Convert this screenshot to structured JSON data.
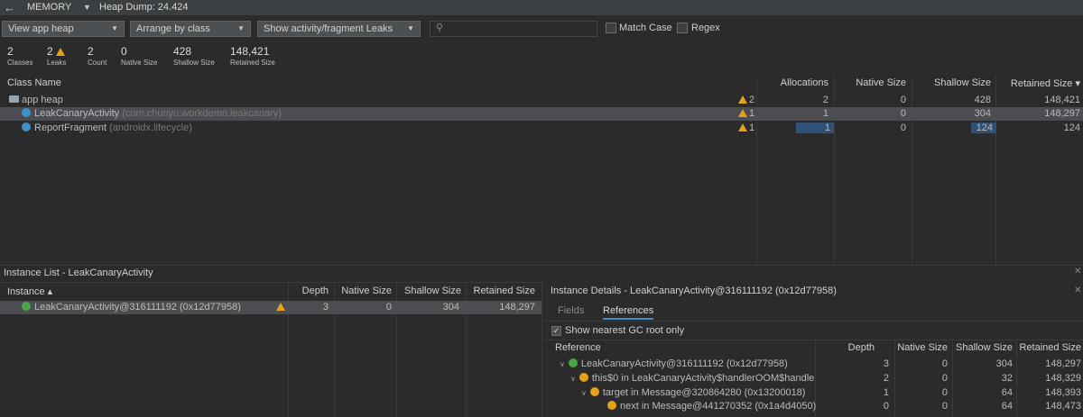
{
  "topbar": {
    "back_icon": "back-arrow-icon",
    "memory_label": "MEMORY",
    "heap_dump": "Heap Dump: 24.424"
  },
  "toolbar": {
    "heap_select": "View app heap",
    "arrange_select": "Arrange by class",
    "leak_select": "Show activity/fragment Leaks",
    "search_placeholder": "",
    "match_case": "Match Case",
    "regex": "Regex"
  },
  "stats": [
    {
      "value": "2",
      "label": "Classes"
    },
    {
      "value": "2",
      "label": "Leaks"
    },
    {
      "value": "2",
      "label": "Count"
    },
    {
      "value": "0",
      "label": "Native Size"
    },
    {
      "value": "428",
      "label": "Shallow Size"
    },
    {
      "value": "148,421",
      "label": "Retained Size"
    }
  ],
  "class_table": {
    "columns": [
      "Class Name",
      "Allocations",
      "Native Size",
      "Shallow Size",
      "Retained Size ▾"
    ],
    "rows": [
      {
        "name": "app heap",
        "pkg": "",
        "leaks": "2",
        "allocations": "2",
        "native": "0",
        "shallow": "428",
        "retained": "148,421"
      },
      {
        "name": "LeakCanaryActivity",
        "pkg": "(com.chunyu.workdemo.leakcanary)",
        "leaks": "1",
        "allocations": "1",
        "native": "0",
        "shallow": "304",
        "retained": "148,297"
      },
      {
        "name": "ReportFragment",
        "pkg": "(androidx.lifecycle)",
        "leaks": "1",
        "allocations": "1",
        "native": "0",
        "shallow": "124",
        "retained": "124"
      }
    ]
  },
  "instance_list": {
    "title": "Instance List - LeakCanaryActivity",
    "columns": [
      "Instance ▴",
      "Depth",
      "Native Size",
      "Shallow Size",
      "Retained Size"
    ],
    "rows": [
      {
        "name": "LeakCanaryActivity@316111192 (0x12d77958)",
        "depth": "3",
        "native": "0",
        "shallow": "304",
        "retained": "148,297"
      }
    ]
  },
  "instance_details": {
    "title": "Instance Details - LeakCanaryActivity@316111192 (0x12d77958)",
    "tabs": [
      "Fields",
      "References"
    ],
    "gc_root_label": "Show nearest GC root only",
    "columns": [
      "Reference",
      "Depth",
      "Native Size",
      "Shallow Size",
      "Retained Size"
    ],
    "rows": [
      {
        "name": "LeakCanaryActivity@316111192 (0x12d77958)",
        "depth": "3",
        "native": "0",
        "shallow": "304",
        "retained": "148,297"
      },
      {
        "name": "this$0 in LeakCanaryActivity$handlerOOM$handle",
        "depth": "2",
        "native": "0",
        "shallow": "32",
        "retained": "148,329"
      },
      {
        "name": "target in Message@320864280 (0x13200018)",
        "depth": "1",
        "native": "0",
        "shallow": "64",
        "retained": "148,393"
      },
      {
        "name": "next in Message@441270352 (0x1a4d4050)",
        "depth": "0",
        "native": "0",
        "shallow": "64",
        "retained": "148,473"
      }
    ]
  },
  "colors": {
    "background": "#2b2b2b",
    "selected_row": "#4b4d50",
    "highlight_cell": "#2f5177",
    "warning": "#e5a11c",
    "class_icon": "#3d91c9",
    "instance_icon": "#49a546"
  }
}
